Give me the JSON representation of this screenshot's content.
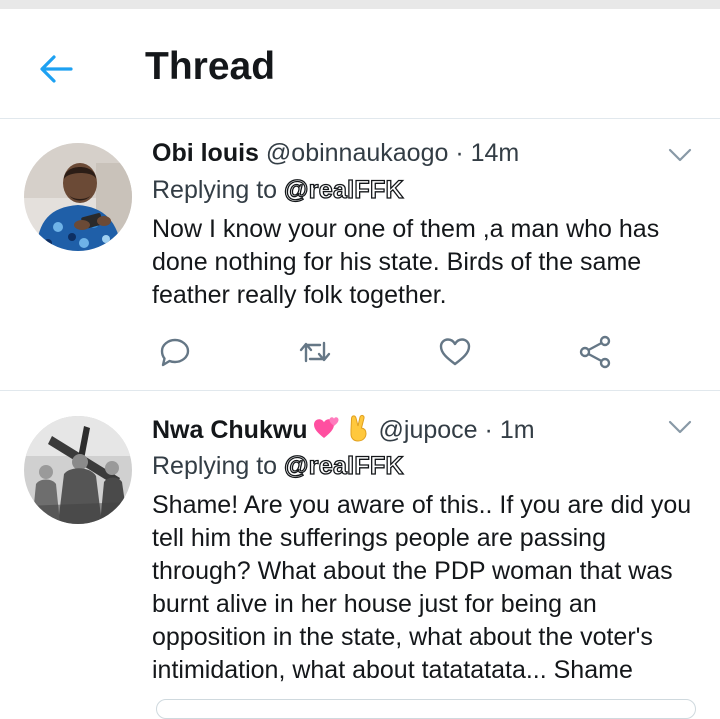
{
  "header": {
    "title": "Thread"
  },
  "tweets": [
    {
      "name": "Obi louis",
      "handle": "@obinnaukaogo",
      "separator": "·",
      "time": "14m",
      "replying_prefix": "Replying to",
      "replying_to": "@realFFK",
      "body_lines": [
        "Now I know your one of them ,a man who has",
        "done nothing for his state. Birds of the same",
        "feather really folk together."
      ]
    },
    {
      "name": "Nwa Chukwu",
      "name_emojis": [
        "two-hearts-emoji",
        "victory-hand-emoji"
      ],
      "handle": "@jupoce",
      "separator": "·",
      "time": "1m",
      "replying_prefix": "Replying to",
      "replying_to": "@realFFK",
      "body_lines": [
        "Shame! Are you aware of this.. If you are did you",
        "tell him the sufferings people are passing",
        "through? What about the PDP woman that was",
        "burnt alive in her house just for being an",
        "opposition in the state, what about the voter's",
        "intimidation, what about tatatatata... Shame"
      ]
    }
  ],
  "icons": {
    "back": "arrow-left-icon",
    "menu": "chevron-down-icon",
    "reply": "reply-icon",
    "retweet": "retweet-icon",
    "like": "heart-icon",
    "share": "share-icon"
  },
  "colors": {
    "accent": "#1da1f2",
    "icon": "#657786",
    "divider": "#e1e8ed"
  }
}
